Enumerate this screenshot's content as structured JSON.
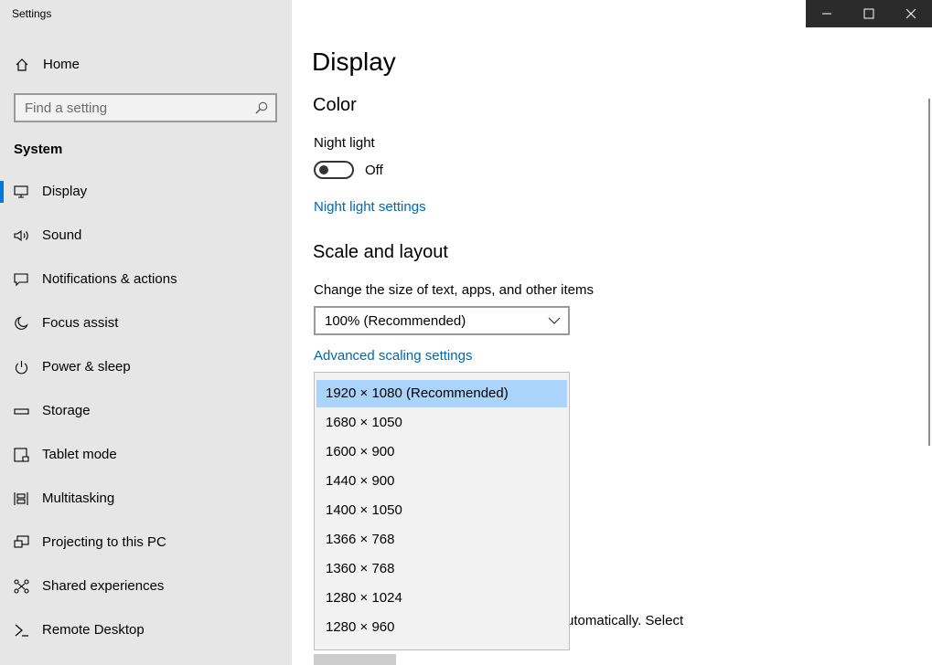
{
  "window": {
    "title": "Settings",
    "minimize_icon": "minimize-icon",
    "maximize_icon": "maximize-icon",
    "close_icon": "close-icon"
  },
  "sidebar": {
    "home_label": "Home",
    "search_placeholder": "Find a setting",
    "section_title": "System",
    "items": [
      {
        "label": "Display",
        "icon": "monitor-icon",
        "active": true
      },
      {
        "label": "Sound",
        "icon": "speaker-icon"
      },
      {
        "label": "Notifications & actions",
        "icon": "message-icon"
      },
      {
        "label": "Focus assist",
        "icon": "moon-icon"
      },
      {
        "label": "Power & sleep",
        "icon": "power-icon"
      },
      {
        "label": "Storage",
        "icon": "drive-icon"
      },
      {
        "label": "Tablet mode",
        "icon": "tablet-icon"
      },
      {
        "label": "Multitasking",
        "icon": "multitask-icon"
      },
      {
        "label": "Projecting to this PC",
        "icon": "project-icon"
      },
      {
        "label": "Shared experiences",
        "icon": "share-icon"
      },
      {
        "label": "Remote Desktop",
        "icon": "remote-icon"
      }
    ]
  },
  "main": {
    "title": "Display",
    "color_heading": "Color",
    "night_light_label": "Night light",
    "night_light_state": "Off",
    "night_light_link": "Night light settings",
    "scale_heading": "Scale and layout",
    "scale_label": "Change the size of text, apps, and other items",
    "scale_value": "100% (Recommended)",
    "advanced_link": "Advanced scaling settings",
    "behind_text": "utomatically. Select"
  },
  "resolution_dropdown": {
    "selected_index": 0,
    "options": [
      "1920 × 1080 (Recommended)",
      "1680 × 1050",
      "1600 × 900",
      "1440 × 900",
      "1400 × 1050",
      "1366 × 768",
      "1360 × 768",
      "1280 × 1024",
      "1280 × 960"
    ]
  },
  "colors": {
    "accent": "#0078d7",
    "link": "#0066b4",
    "selected_option": "#aad4fb"
  }
}
